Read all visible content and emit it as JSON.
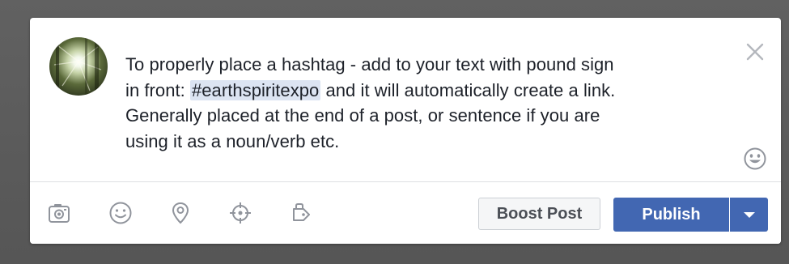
{
  "composer": {
    "text_lines": [
      "To properly place a hashtag - add to your text with pound sign",
      "in front: ",
      " and it will automatically create a link.",
      "Generally placed at the end of a post, or sentence if you are",
      "using it as a noun/verb etc."
    ],
    "hashtag": "#earthspiritexpo",
    "close_icon": "close-icon",
    "emoji_icon": "smiley-icon"
  },
  "toolbar": {
    "tools": [
      {
        "name": "camera-icon"
      },
      {
        "name": "smiley-icon"
      },
      {
        "name": "location-pin-icon"
      },
      {
        "name": "crosshair-icon"
      },
      {
        "name": "tag-icon"
      }
    ],
    "boost_label": "Boost Post",
    "publish_label": "Publish",
    "publish_dropdown_icon": "caret-down-icon"
  },
  "colors": {
    "publish_bg": "#4267b2",
    "hashtag_highlight": "#dce4f2",
    "text": "#1d2129",
    "icon_gray": "#90949c"
  }
}
